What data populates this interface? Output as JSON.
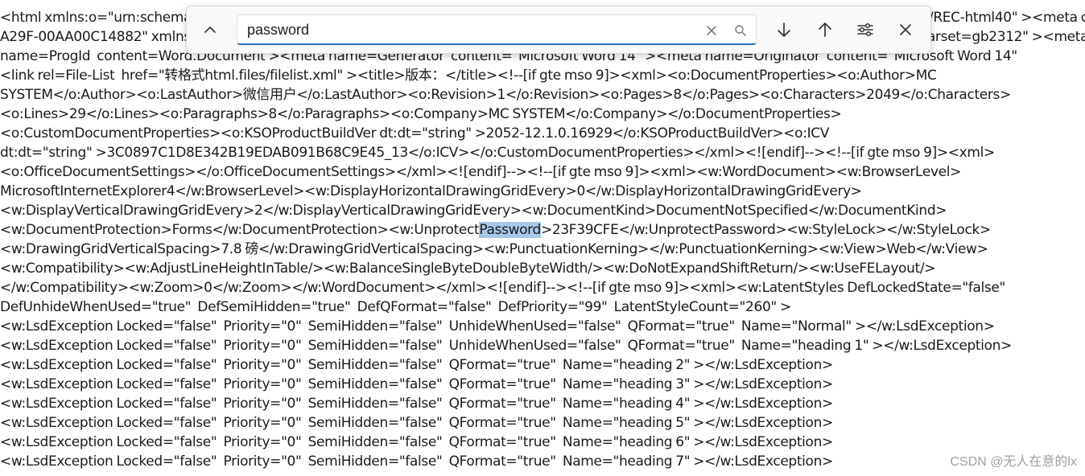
{
  "find_bar": {
    "query": "password"
  },
  "document": {
    "lines": [
      [
        {
          "t": "<html xmlns:o=\"urn:schemas-microsoft-com:office:office\" xmlns:w=\"urn:schemas-microsoft-com:office:word\" xmlns=\"http://www.w3.org/TR/REC-html40\" ><meta classid=\"CLSID:1010-65B3-11d1-"
        }
      ],
      [
        {
          "t": "A29F-00AA00C14882\" xmlns:x=\"urn:schemas-microsoft-com:office:excel\" ><head><meta http-equiv=Content-Type content=\"text/html; charset=gb2312\" ><meta"
        }
      ],
      [
        {
          "t": "name=ProgId  content=Word.Document ><meta name=Generator  content=\"Microsoft Word 14\" ><meta name=Originator  content=\"Microsoft Word 14\""
        }
      ],
      [
        {
          "t": "<link rel=File-List  href=\"转格式html.files/filelist.xml\" ><title>版本：</title><!--[if gte mso 9]><xml><o:DocumentProperties><o:Author>MC"
        }
      ],
      [
        {
          "t": "SYSTEM</o:Author><o:LastAuthor>微信用户</o:LastAuthor><o:Revision>1</o:Revision><o:Pages>8</o:Pages><o:Characters>2049</o:Characters>"
        }
      ],
      [
        {
          "t": "<o:Lines>29</o:Lines><o:Paragraphs>8</o:Paragraphs><o:Company>MC SYSTEM</o:Company></o:DocumentProperties>"
        }
      ],
      [
        {
          "t": "<o:CustomDocumentProperties><o:KSOProductBuildVer dt:dt=\"string\" >2052-12.1.0.16929</o:KSOProductBuildVer><o:ICV"
        }
      ],
      [
        {
          "t": "dt:dt=\"string\" >3C0897C1D8E342B19EDAB091B68C9E45_13</o:ICV></o:CustomDocumentProperties></xml><![endif]--><!--[if gte mso 9]><xml>"
        }
      ],
      [
        {
          "t": "<o:OfficeDocumentSettings></o:OfficeDocumentSettings></xml><![endif]--><!--[if gte mso 9]><xml><w:WordDocument><w:BrowserLevel>"
        }
      ],
      [
        {
          "t": "MicrosoftInternetExplorer4</w:BrowserLevel><w:DisplayHorizontalDrawingGridEvery>0</w:DisplayHorizontalDrawingGridEvery>"
        }
      ],
      [
        {
          "t": "<w:DisplayVerticalDrawingGridEvery>2</w:DisplayVerticalDrawingGridEvery><w:DocumentKind>DocumentNotSpecified</w:DocumentKind>"
        }
      ],
      [
        {
          "t": "<w:DocumentProtection>Forms</w:DocumentProtection><w:Unprotect"
        },
        {
          "t": "Password",
          "hl": true
        },
        {
          "t": ">23F39CFE</w:UnprotectPassword><w:StyleLock></w:StyleLock>"
        }
      ],
      [
        {
          "t": "<w:DrawingGridVerticalSpacing>7.8 磅</w:DrawingGridVerticalSpacing><w:PunctuationKerning></w:PunctuationKerning><w:View>Web</w:View>"
        }
      ],
      [
        {
          "t": "<w:Compatibility><w:AdjustLineHeightInTable/><w:BalanceSingleByteDoubleByteWidth/><w:DoNotExpandShiftReturn/><w:UseFELayout/>"
        }
      ],
      [
        {
          "t": "</w:Compatibility><w:Zoom>0</w:Zoom></w:WordDocument></xml><![endif]--><!--[if gte mso 9]><xml><w:LatentStyles DefLockedState=\"false\""
        }
      ],
      [
        {
          "t": "DefUnhideWhenUsed=\"true\"  DefSemiHidden=\"true\"  DefQFormat=\"false\"  DefPriority=\"99\"  LatentStyleCount=\"260\" >"
        }
      ],
      [
        {
          "t": "<w:LsdException Locked=\"false\"  Priority=\"0\"  SemiHidden=\"false\"  UnhideWhenUsed=\"false\"  QFormat=\"true\"  Name=\"Normal\" ></w:LsdException>"
        }
      ],
      [
        {
          "t": "<w:LsdException Locked=\"false\"  Priority=\"0\"  SemiHidden=\"false\"  UnhideWhenUsed=\"false\"  QFormat=\"true\"  Name=\"heading 1\" ></w:LsdException>"
        }
      ],
      [
        {
          "t": "<w:LsdException Locked=\"false\"  Priority=\"0\"  SemiHidden=\"false\"  QFormat=\"true\"  Name=\"heading 2\" ></w:LsdException>"
        }
      ],
      [
        {
          "t": "<w:LsdException Locked=\"false\"  Priority=\"0\"  SemiHidden=\"false\"  QFormat=\"true\"  Name=\"heading 3\" ></w:LsdException>"
        }
      ],
      [
        {
          "t": "<w:LsdException Locked=\"false\"  Priority=\"0\"  SemiHidden=\"false\"  QFormat=\"true\"  Name=\"heading 4\" ></w:LsdException>"
        }
      ],
      [
        {
          "t": "<w:LsdException Locked=\"false\"  Priority=\"0\"  SemiHidden=\"false\"  QFormat=\"true\"  Name=\"heading 5\" ></w:LsdException>"
        }
      ],
      [
        {
          "t": "<w:LsdException Locked=\"false\"  Priority=\"0\"  SemiHidden=\"false\"  QFormat=\"true\"  Name=\"heading 6\" ></w:LsdException>"
        }
      ],
      [
        {
          "t": "<w:LsdException Locked=\"false\"  Priority=\"0\"  SemiHidden=\"false\"  QFormat=\"true\"  Name=\"heading 7\" ></w:LsdException>"
        }
      ]
    ]
  },
  "watermark": "CSDN @无人在意的lx",
  "colors": {
    "highlight": "#a8c8e8",
    "input_underline": "#2f6fb3",
    "text": "#1a1a1a"
  },
  "icons": [
    "chevron-up-icon",
    "clear-icon",
    "search-icon",
    "arrow-down-icon",
    "arrow-up-icon",
    "filter-options-icon",
    "close-icon"
  ]
}
